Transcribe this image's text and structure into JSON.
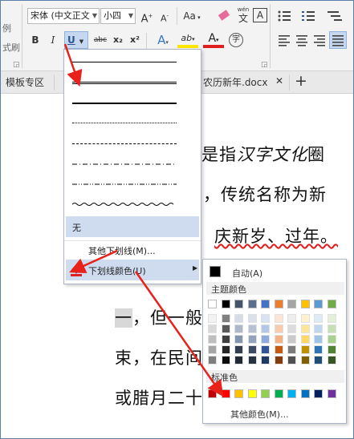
{
  "ribbon": {
    "left_fragment_1": "例",
    "left_fragment_2": "式刷",
    "font_name": "宋体 (中文正文",
    "font_size": "小四",
    "grow_font": "A",
    "shrink_font": "A",
    "aa_label": "Aa",
    "wen_label": "wén",
    "wen_char": "文",
    "boxed_a": "A",
    "bold": "B",
    "italic": "I",
    "underline": "U",
    "strikethrough": "abc",
    "subscript": "x₂",
    "superscript": "x²",
    "effect_a": "A",
    "highlight": "ab",
    "font_color": "A",
    "enclose_char": "字"
  },
  "tabbar": {
    "tab1": "模板专区",
    "tab2": "农历新年.docx",
    "close": "✕",
    "add": "+"
  },
  "underline_menu": {
    "none_label": "无",
    "more_label": "其他下划线(M)...",
    "color_label": "下划线颜色(U)"
  },
  "color_panel": {
    "auto_label": "自动(A)",
    "theme_label": "主题颜色",
    "standard_label": "标准色",
    "more_label": "其他颜色(M)...",
    "theme_top": [
      "#ffffff",
      "#000000",
      "#44546a",
      "#5b6f8e",
      "#4472c4",
      "#ed7d31",
      "#a5a5a5",
      "#ffc000",
      "#5b9bd5",
      "#70ad47"
    ],
    "theme_shades": [
      [
        "#f2f2f2",
        "#7f7f7f",
        "#d6dce5",
        "#dbe0e9",
        "#dae3f3",
        "#fbe5d6",
        "#ededed",
        "#fff2cc",
        "#deebf7",
        "#e2f0d9"
      ],
      [
        "#d9d9d9",
        "#595959",
        "#adb9ca",
        "#b7c1d3",
        "#b4c7e7",
        "#f8cbad",
        "#dbdbdb",
        "#ffe699",
        "#bdd7ee",
        "#c5e0b4"
      ],
      [
        "#bfbfbf",
        "#404040",
        "#8497b0",
        "#93a2bd",
        "#8faadc",
        "#f4b183",
        "#c9c9c9",
        "#ffd966",
        "#9dc3e6",
        "#a9d18e"
      ],
      [
        "#a6a6a6",
        "#262626",
        "#323f4f",
        "#3c4a62",
        "#2f5597",
        "#c55a11",
        "#7b7b7b",
        "#bf9000",
        "#2e75b6",
        "#538135"
      ],
      [
        "#7f7f7f",
        "#0d0d0d",
        "#222a35",
        "#28313f",
        "#1f3864",
        "#843c0c",
        "#525252",
        "#7f6000",
        "#1f4e79",
        "#375623"
      ]
    ],
    "standard": [
      "#c00000",
      "#ff0000",
      "#ffc000",
      "#ffff00",
      "#92d050",
      "#00b050",
      "#00b0f0",
      "#0070c0",
      "#002060",
      "#7030a0"
    ]
  },
  "document": {
    "line1_plain": "是指",
    "line1_italic": "汉字文化",
    "line1_end": "圈",
    "line2": "，传统名称为新",
    "line3": "庆新岁、过年。",
    "line4_hl": "一",
    "line4": "，但一般",
    "line5": "束，在民间",
    "line6": "或腊月二十"
  },
  "colors": {
    "arrow": "#e8211b",
    "accent_blue": "#2b579a",
    "menu_highlight": "#c5d8ef",
    "red_underline": "#e02020"
  }
}
